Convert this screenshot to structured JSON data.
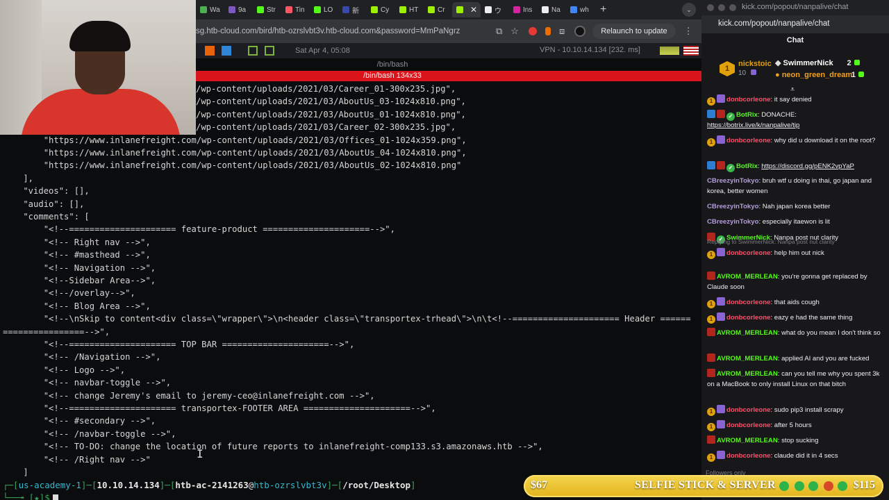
{
  "browser": {
    "tabs": [
      {
        "label": "Wa",
        "color": "#4caf50"
      },
      {
        "label": "9a",
        "color": "#7e57c2"
      },
      {
        "label": "Str",
        "color": "#53fc18"
      },
      {
        "label": "Tin",
        "color": "#ff5864"
      },
      {
        "label": "LO",
        "color": "#53fc18"
      },
      {
        "label": "新",
        "color": "#3949ab"
      },
      {
        "label": "Cy",
        "color": "#9fef00"
      },
      {
        "label": "HT",
        "color": "#9fef00"
      },
      {
        "label": "Cr",
        "color": "#9fef00"
      },
      {
        "label": "",
        "color": "#9fef00"
      },
      {
        "label": "ウ",
        "color": "#eeeeee"
      },
      {
        "label": "Ins",
        "color": "#d6249f"
      },
      {
        "label": "Na",
        "color": "#eeeeee"
      },
      {
        "label": "wh",
        "color": "#4285f4"
      }
    ],
    "url": "sg.htb-cloud.com/bird/htb-ozrslvbt3v.htb-cloud.com&password=MmPaNgrz",
    "relaunch_label": "Relaunch to update"
  },
  "vm": {
    "clock": "Sat Apr 4, 05:08",
    "vpn": "VPN - 10.10.14.134 [232. ms]",
    "term_title": "/bin/bash",
    "term_subtitle": "/bin/bash 134x33"
  },
  "terminal": {
    "lines": [
      "/wp-content/uploads/2021/03/Career_01-300x235.jpg\",",
      "/wp-content/uploads/2021/03/AboutUs_03-1024x810.png\",",
      "/wp-content/uploads/2021/03/AboutUs_01-1024x810.png\",",
      "/wp-content/uploads/2021/03/Career_02-300x235.jpg\",",
      "        \"https://www.inlanefreight.com/wp-content/uploads/2021/03/Offices_01-1024x359.png\",",
      "        \"https://www.inlanefreight.com/wp-content/uploads/2021/03/AboutUs_04-1024x810.png\",",
      "        \"https://www.inlanefreight.com/wp-content/uploads/2021/03/AboutUs_02-1024x810.png\"",
      "    ],",
      "    \"videos\": [],",
      "    \"audio\": [],",
      "    \"comments\": [",
      "        \"<!--===================== feature-product =====================-->\",",
      "        \"<!-- Right nav -->\",",
      "        \"<!-- #masthead -->\",",
      "        \"<!-- Navigation -->\",",
      "        \"<!--Sidebar Area-->\",",
      "        \"<!--/overlay-->\",",
      "        \"<!-- Blog Area -->\",",
      "        \"<!--\\nSkip to content<div class=\\\"wrapper\\\">\\n<header class=\\\"transportex-trhead\\\">\\n\\t<!--===================== Header ======",
      "================-->\",",
      "        \"<!--===================== TOP BAR =====================-->\",",
      "        \"<!-- /Navigation -->\",",
      "        \"<!-- Logo -->\",",
      "        \"<!-- navbar-toggle -->\",",
      "        \"<!-- change Jeremy's email to jeremy-ceo@inlanefreight.com -->\",",
      "        \"<!--===================== transportex-FOOTER AREA =====================-->\",",
      "        \"<!-- #secondary -->\",",
      "        \"<!-- /navbar-toggle -->\",",
      "        \"<!-- TO-DO: change the location of future reports to inlanefreight-comp133.s3.amazonaws.htb -->\",",
      "        \"<!-- /Right nav -->\"",
      "    ]"
    ],
    "prompt_user": "us-academy-1",
    "prompt_ip": "10.10.14.134",
    "prompt_host_a": "htb-ac-2141263",
    "prompt_host_b": "htb-ozrslvbt3v",
    "prompt_path": "/root/Desktop",
    "prompt2": "└──╼ [★]$"
  },
  "chat_window": {
    "title": "kick.com/popout/nanpalive/chat",
    "url": "kick.com/popout/nanpalive/chat",
    "header": "Chat"
  },
  "pinned": {
    "name": "nickstoic",
    "count": "10",
    "leaders": [
      {
        "name": "SwimmerNick",
        "value": "2",
        "color": "#ffffff"
      },
      {
        "name": "neon_green_dream",
        "value": "1",
        "color": "#f0a020"
      }
    ]
  },
  "messages": [
    {
      "user": "donbcorleone",
      "color": "#ff4f6d",
      "text": ": it say denied",
      "badges": [
        "gold",
        "purp"
      ]
    },
    {
      "user": "BotRix",
      "color": "#53fc18",
      "text": ": DONACHE: ",
      "link": "https://botrix.live/k/nanpalive/tip",
      "badges": [
        "blue",
        "red",
        "green"
      ]
    },
    {
      "user": "donbcorleone",
      "color": "#ff4f6d",
      "text": ": why did u download it on the root?",
      "badges": [
        "gold",
        "purp"
      ]
    },
    {
      "user": "BotRix",
      "color": "#53fc18",
      "text": ": ",
      "link": "https://discord.gg/pENK2vpYaP",
      "badges": [
        "blue",
        "red",
        "green"
      ]
    },
    {
      "user": "CBreezyinTokyo",
      "color": "#b39ddb",
      "text": ": bruh wtf u doing in thai, go japan and korea, better women",
      "badges": []
    },
    {
      "user": "CBreezyinTokyo",
      "color": "#b39ddb",
      "text": ": Nah japan korea better",
      "badges": []
    },
    {
      "user": "CBreezyinTokyo",
      "color": "#b39ddb",
      "text": ": especially itaewon is lit",
      "badges": []
    },
    {
      "user": "SwimmerNick",
      "color": "#53fc18",
      "text": ": Nanpa post nut clarity",
      "badges": [
        "red",
        "green"
      ]
    },
    {
      "user": "donbcorleone",
      "color": "#ff4f6d",
      "text": ": help him out nick",
      "badges": [
        "gold",
        "purp"
      ],
      "reply": "Replying to SwimmerNick: Nanpa post nut clarity"
    },
    {
      "user": "AVROM_MERLEAN",
      "color": "#53fc18",
      "text": ": you're gonna get replaced by Claude soon",
      "badges": [
        "red"
      ]
    },
    {
      "user": "donbcorleone",
      "color": "#ff4f6d",
      "text": ": that aids cough",
      "badges": [
        "gold",
        "purp"
      ]
    },
    {
      "user": "donbcorleone",
      "color": "#ff4f6d",
      "text": ": eazy e had the same thing",
      "badges": [
        "gold",
        "purp"
      ]
    },
    {
      "user": "AVROM_MERLEAN",
      "color": "#53fc18",
      "text": ": what do you mean I don't think so",
      "badges": [
        "red"
      ]
    },
    {
      "user": "AVROM_MERLEAN",
      "color": "#53fc18",
      "text": ": applied AI and you are fucked",
      "badges": [
        "red"
      ]
    },
    {
      "user": "AVROM_MERLEAN",
      "color": "#53fc18",
      "text": ": can you tell me why you spent 3k on a MacBook to only install Linux on that bitch",
      "badges": [
        "red"
      ]
    },
    {
      "user": "donbcorleone",
      "color": "#ff4f6d",
      "text": ": sudo pip3 install scrapy",
      "badges": [
        "gold",
        "purp"
      ]
    },
    {
      "user": "donbcorleone",
      "color": "#ff4f6d",
      "text": ": after 5 hours",
      "badges": [
        "gold",
        "purp"
      ]
    },
    {
      "user": "AVROM_MERLEAN",
      "color": "#53fc18",
      "text": ": stop sucking",
      "badges": [
        "red"
      ]
    },
    {
      "user": "donbcorleone",
      "color": "#ff4f6d",
      "text": ": claude did it in 4 secs",
      "badges": [
        "gold",
        "purp"
      ]
    }
  ],
  "followers_only": "Followers only",
  "goal": {
    "current": "$67",
    "title": "SELFIE STICK & SERVER",
    "target": "$115"
  }
}
